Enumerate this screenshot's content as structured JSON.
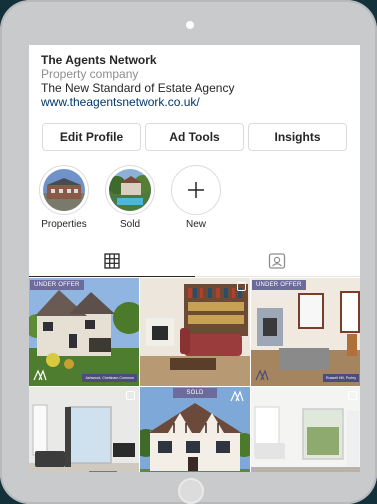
{
  "profile": {
    "name": "The Agents Network",
    "category": "Property company",
    "bio": "The New Standard of Estate Agency",
    "website": "www.theagentsnetwork.co.uk/"
  },
  "actions": {
    "edit_profile": "Edit Profile",
    "ad_tools": "Ad Tools",
    "insights": "Insights"
  },
  "highlights": [
    {
      "label": "Properties"
    },
    {
      "label": "Sold"
    },
    {
      "label": "New"
    }
  ],
  "tabs": [
    {
      "icon": "grid-icon",
      "active": true
    },
    {
      "icon": "tagged-icon",
      "active": false
    }
  ],
  "posts": [
    {
      "badge": "UNDER OFFER",
      "caption": "Ashwood, Chelsham Common",
      "multi": false
    },
    {
      "badge": "",
      "caption": "",
      "multi": true
    },
    {
      "badge": "UNDER OFFER",
      "caption": "Russell Hill, Purley",
      "multi": false
    },
    {
      "badge": "",
      "caption": "",
      "multi": true
    },
    {
      "badge": "SOLD",
      "caption": "",
      "multi": false
    },
    {
      "badge": "",
      "caption": "",
      "multi": true
    }
  ],
  "colors": {
    "badge": "#6b6b9c",
    "link": "#00376b",
    "frame": "#c9cacb",
    "background": "#12313a"
  }
}
